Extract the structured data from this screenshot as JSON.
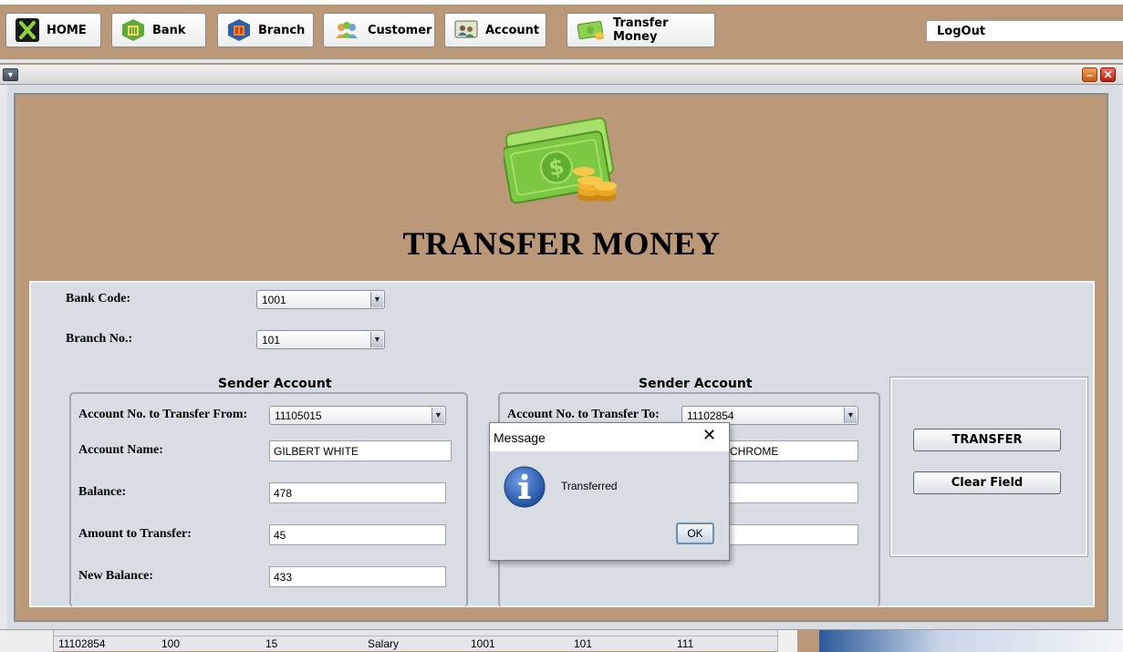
{
  "nav": {
    "home": "HOME",
    "bank": "Bank",
    "branch": "Branch",
    "customer": "Customer",
    "account": "Account",
    "transfer": "Transfer Money",
    "logout": "LogOut"
  },
  "page": {
    "title": "TRANSFER MONEY"
  },
  "form": {
    "bank_code_label": "Bank Code:",
    "bank_code_value": "1001",
    "branch_label": "Branch No.:",
    "branch_value": "101"
  },
  "sender": {
    "title": "Sender Account",
    "account_from_label": "Account No. to Transfer From:",
    "account_from_value": "11105015",
    "name_label": "Account Name:",
    "name_value": "GILBERT WHITE",
    "balance_label": "Balance:",
    "balance_value": "478",
    "amount_label": "Amount to Transfer:",
    "amount_value": "45",
    "new_balance_label": "New Balance:",
    "new_balance_value": "433"
  },
  "receiver": {
    "title": "Sender Account",
    "account_to_label": "Account No. to Transfer To:",
    "account_to_value": "11102854",
    "name_value_visible": "CHROME"
  },
  "actions": {
    "transfer": "TRANSFER",
    "clear": "Clear Field"
  },
  "dialog": {
    "title": "Message",
    "message": "Transferred",
    "ok": "OK",
    "close_glyph": "✕"
  },
  "table_row": [
    "11102854",
    "100",
    "15",
    "Salary",
    "1001",
    "101",
    "111"
  ],
  "icons": {
    "menu": "chevron-down-icon",
    "minimize": "minimize-icon",
    "close": "close-icon",
    "info": "info-icon"
  },
  "colors": {
    "background": "#bb9878",
    "form": "#d8dde4",
    "info_blue": "#2f64b6"
  }
}
